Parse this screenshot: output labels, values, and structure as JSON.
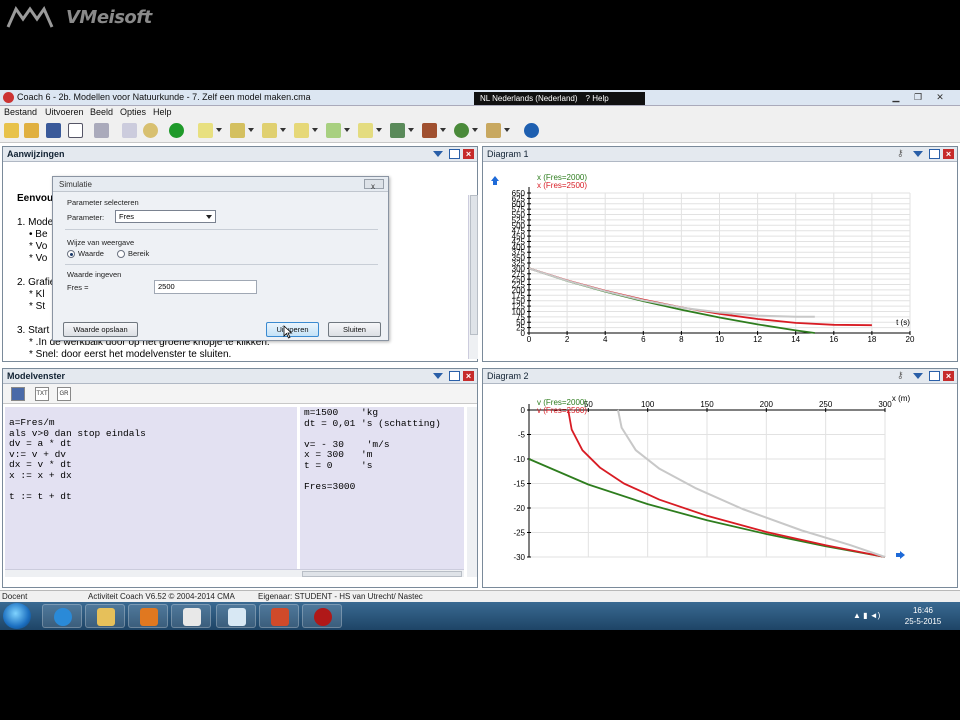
{
  "watermark": {
    "brand": "VMeisoft"
  },
  "window": {
    "title": "Coach 6 - 2b. Modellen voor Natuurkunde - 7. Zelf een model maken.cma",
    "language": "NL Nederlands (Nederland)",
    "help": "Help"
  },
  "menu": [
    "Bestand",
    "Uitvoeren",
    "Beeld",
    "Opties",
    "Help"
  ],
  "instructions_panel": {
    "title": "Aanwijzingen",
    "heading": "Eenvou",
    "lines": [
      {
        "text": "1. Mode"
      },
      {
        "text": "•  Be"
      },
      {
        "text": "*  Vo"
      },
      {
        "text": "*  Vo"
      },
      {
        "text": "2. Grafie"
      },
      {
        "text": "*  Kl"
      },
      {
        "text": "*  St"
      },
      {
        "text": "3. Start"
      },
      {
        "text": "*  .In de werkbalk door op het groene knopje te klikken."
      },
      {
        "text": "*  Snel: door eerst het modelvenster te sluiten."
      }
    ]
  },
  "model_panel": {
    "title": "Modelvenster",
    "left_lines": [
      "a=Fres/m",
      "als v>0 dan stop eindals",
      "dv = a * dt",
      "v:= v + dv",
      "dx = v * dt",
      "x := x + dx",
      "",
      "t := t + dt"
    ],
    "right_lines": [
      "m=1500    'kg",
      "dt = 0,01 's (schatting)",
      "",
      "v= - 30    'm/s",
      "x = 300   'm",
      "t = 0     's",
      "",
      "Fres=3000"
    ]
  },
  "dialog": {
    "title": "Simulatie",
    "group_param": "Parameter selecteren",
    "param_label": "Parameter:",
    "param_value": "Fres",
    "group_mode": "Wijze van weergave",
    "mode_options": [
      "Waarde",
      "Bereik"
    ],
    "mode_selected": "Waarde",
    "group_input": "Waarde ingeven",
    "input_label": "Fres =",
    "input_value": "2500",
    "btn_save": "Waarde opslaan",
    "btn_run": "Uitvoeren",
    "btn_close": "Sluiten",
    "close_icon": "x"
  },
  "diagram1": {
    "title": "Diagram 1"
  },
  "diagram2": {
    "title": "Diagram 2"
  },
  "statusbar": {
    "mode": "Docent",
    "activity": "Activiteit Coach V6.52 © 2004-2014 CMA",
    "owner": "Eigenaar: STUDENT - HS van Utrecht/ Nastec"
  },
  "taskbar": {
    "time": "16:46",
    "date": "25-5-2015"
  },
  "colors": {
    "green": "#2e7d1e",
    "red": "#d81c24",
    "grey": "#c8c8c8",
    "accent": "#2a5fa8"
  },
  "chart_data": [
    {
      "type": "line",
      "title": "Diagram 1",
      "xlabel": "t (s)",
      "ylabel": "",
      "xlim": [
        0,
        20
      ],
      "ylim": [
        0,
        650
      ],
      "xticks": [
        0,
        2,
        4,
        6,
        8,
        10,
        12,
        14,
        16,
        18,
        20
      ],
      "yticks": [
        0,
        25,
        50,
        75,
        100,
        125,
        150,
        175,
        200,
        225,
        250,
        275,
        300,
        325,
        350,
        375,
        400,
        425,
        450,
        475,
        500,
        525,
        550,
        575,
        600,
        625,
        650
      ],
      "grid": true,
      "legend": "top-left",
      "series": [
        {
          "name": "x (Fres=2000)",
          "color": "green",
          "x": [
            0,
            2,
            4,
            6,
            8,
            10,
            12,
            14,
            15
          ],
          "y": [
            300,
            242,
            192,
            148,
            108,
            72,
            40,
            12,
            0
          ]
        },
        {
          "name": "x (Fres=2500)",
          "color": "red",
          "x": [
            0,
            2,
            4,
            6,
            8,
            10,
            12,
            14,
            16,
            18
          ],
          "y": [
            300,
            244,
            196,
            155,
            119,
            89,
            65,
            47,
            38,
            36
          ]
        },
        {
          "name": "",
          "color": "grey",
          "x": [
            0,
            2,
            4,
            6,
            8,
            10,
            12,
            14,
            15
          ],
          "y": [
            300,
            243,
            194,
            152,
            118,
            95,
            81,
            75,
            75
          ]
        }
      ]
    },
    {
      "type": "line",
      "title": "Diagram 2",
      "xlabel": "x (m)",
      "ylabel": "",
      "xlim": [
        0,
        300
      ],
      "ylim": [
        -30,
        0
      ],
      "xticks": [
        50,
        100,
        150,
        200,
        250,
        300
      ],
      "yticks": [
        0,
        -5,
        -10,
        -15,
        -20,
        -25,
        -30
      ],
      "grid": true,
      "legend": "top-left",
      "series": [
        {
          "name": "v (Fres=2000)",
          "color": "green",
          "x": [
            0,
            50,
            100,
            150,
            200,
            250,
            300
          ],
          "y": [
            -10,
            -15.2,
            -19.2,
            -22.5,
            -25.3,
            -27.8,
            -30
          ]
        },
        {
          "name": "v (Fres=2500)",
          "color": "red",
          "x": [
            33,
            36,
            45,
            60,
            80,
            110,
            150,
            200,
            250,
            300
          ],
          "y": [
            0,
            -4,
            -8.2,
            -11.8,
            -15,
            -18.3,
            -21.6,
            -24.9,
            -27.6,
            -30
          ]
        },
        {
          "name": "",
          "color": "grey",
          "x": [
            75,
            78,
            90,
            110,
            140,
            180,
            230,
            270,
            300
          ],
          "y": [
            0,
            -3.6,
            -8.2,
            -12,
            -15.9,
            -20.2,
            -24.6,
            -27.5,
            -30
          ]
        }
      ]
    }
  ]
}
